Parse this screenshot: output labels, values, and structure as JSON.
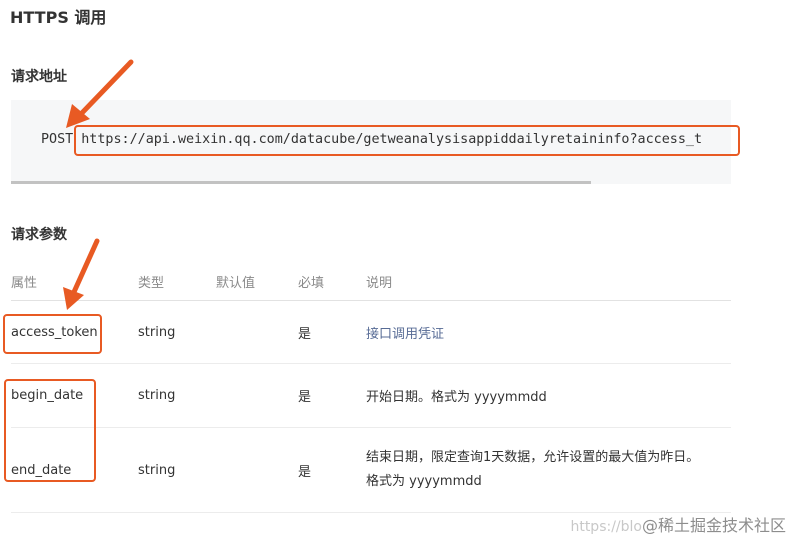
{
  "page": {
    "title": "HTTPS 调用"
  },
  "request_address": {
    "heading": "请求地址",
    "method": "POST",
    "url": "https://api.weixin.qq.com/datacube/getweanalysisappiddailyretaininfo?access_t"
  },
  "request_params": {
    "heading": "请求参数",
    "columns": [
      "属性",
      "类型",
      "默认值",
      "必填",
      "说明"
    ],
    "rows": [
      {
        "name": "access_token",
        "type": "string",
        "default": "",
        "required": "是",
        "description": "接口调用凭证"
      },
      {
        "name": "begin_date",
        "type": "string",
        "default": "",
        "required": "是",
        "description": "开始日期。格式为 yyyymmdd"
      },
      {
        "name": "end_date",
        "type": "string",
        "default": "",
        "required": "是",
        "description_line1": "结束日期，限定查询1天数据，允许设置的最大值为昨日。",
        "description_line2": "格式为 yyyymmdd"
      }
    ]
  },
  "watermark": {
    "url_part": "https://blo",
    "brand": "@稀土掘金技术社区"
  },
  "colors": {
    "highlight": "#e85a23",
    "link": "#576b95",
    "code_background": "#f6f7f8"
  }
}
